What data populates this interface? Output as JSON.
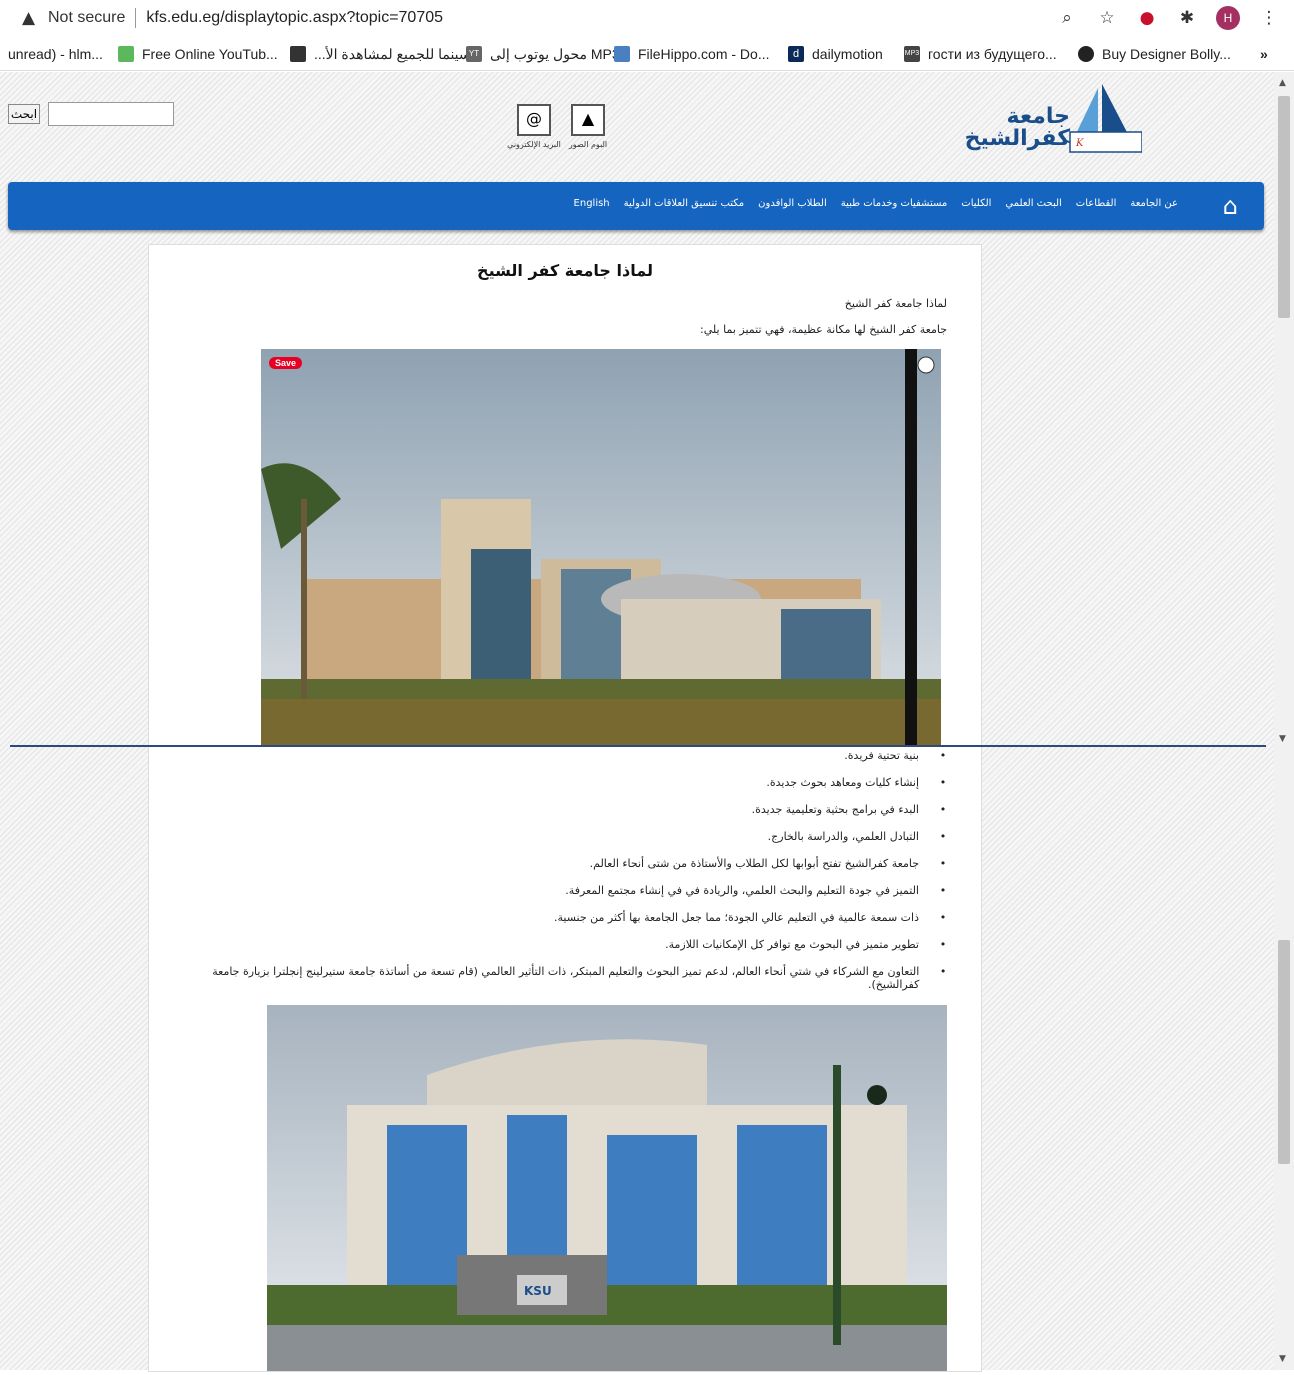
{
  "browser": {
    "security_label": "Not secure",
    "url": "kfs.edu.eg/displaytopic.aspx?topic=70705",
    "bookmarks": [
      "unread) - hlm...",
      "Free Online YouTub...",
      "السينما للجميع لمشاهدة الأ...",
      "محول يوتوب إلى MP3",
      "FileHippo.com - Do...",
      "dailymotion",
      "гости из будущего...",
      "Buy Designer Bolly..."
    ],
    "more_bookmarks": "»",
    "avatar_letter": "H"
  },
  "header": {
    "search_button": "ابحث",
    "search_value": "",
    "quick_links": [
      "البريد الإلكتروني",
      "البوم الصور"
    ],
    "logo_text": "جامعة كفرالشيخ"
  },
  "nav": {
    "items": [
      "عن الجامعة",
      "القطاعات",
      "البحث العلمي",
      "الكليات",
      "مستشفيات وخدمات طبية",
      "الطلاب الوافدون",
      "مكتب تنسيق العلاقات الدولية",
      "English"
    ]
  },
  "article": {
    "title": "لماذا جامعة كفر الشيخ",
    "intro1": "لماذا جامعة كفر الشيخ",
    "intro2": "جامعة كفر الشيخ لها مكانة عظيمة، فهي تتميز بما يلي:",
    "image_badge": "Save",
    "bullets": [
      "بنية تحتية فريدة.",
      "إنشاء كليات ومعاهد بحوث جديدة.",
      "البدء في برامج بحثية وتعليمية جديدة.",
      "التبادل العلمي، والدراسة بالخارج.",
      "جامعة كفرالشيخ تفتح أبوابها لكل الطلاب والأستاذة من شتى أنحاء العالم.",
      "التميز في جودة التعليم والبحث العلمي، والريادة في في إنشاء مجتمع المعرفة.",
      "ذات سمعة عالمية في التعليم عالي الجودة؛ مما جعل الجامعة بها أكثر من جنسية.",
      "تطوير متميز في البحوث مع توافر كل الإمكانيات اللازمة.",
      "التعاون مع الشركاء في شتي أنحاء العالم، لدعم تميز البحوث والتعليم المبتكر، ذات التأثير العالمي (قام تسعة من أساتذة جامعة ستيرلينج إنجلترا بزيارة جامعة كفرالشيخ)."
    ],
    "photo_sign": "KSU"
  },
  "colors": {
    "nav": "#1565c0",
    "pinterest": "#e60023"
  }
}
